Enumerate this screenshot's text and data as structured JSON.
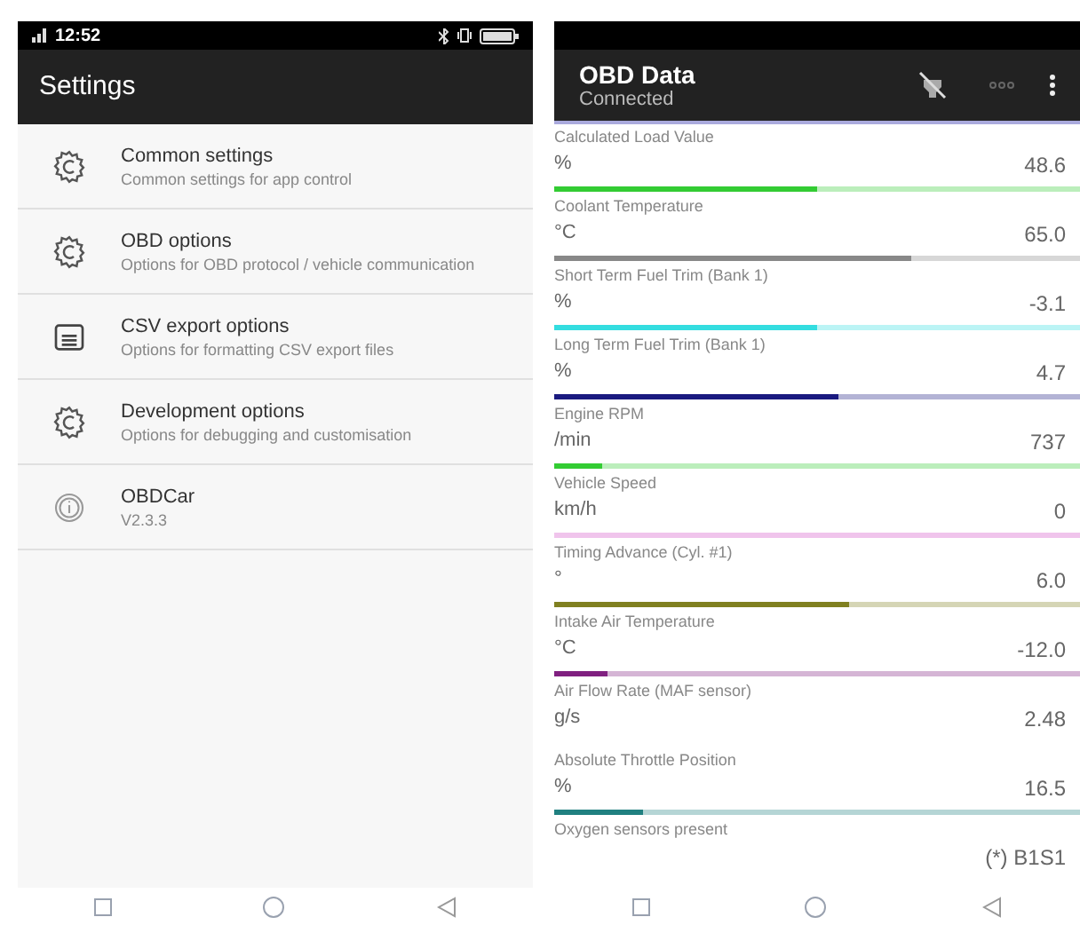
{
  "left_screen": {
    "status_bar": {
      "time": "12:52"
    },
    "title": "Settings",
    "items": [
      {
        "kind": "gear",
        "title": "Common settings",
        "subtitle": "Common settings for app control"
      },
      {
        "kind": "gear",
        "title": "OBD options",
        "subtitle": "Options for OBD protocol / vehicle communication"
      },
      {
        "kind": "document",
        "title": "CSV export options",
        "subtitle": "Options for formatting CSV export files"
      },
      {
        "kind": "gear",
        "title": "Development options",
        "subtitle": "Options for debugging and customisation"
      },
      {
        "kind": "info",
        "title": "OBDCar",
        "subtitle": "V2.3.3"
      }
    ]
  },
  "right_screen": {
    "title": "OBD Data",
    "subtitle": "Connected",
    "rows": [
      {
        "name": "Calculated Load Value",
        "unit": "%",
        "value": "48.6",
        "level": 0.5,
        "color": "#33cc33"
      },
      {
        "name": "Coolant Temperature",
        "unit": "°C",
        "value": "65.0",
        "level": 0.68,
        "color": "#888888"
      },
      {
        "name": "Short Term Fuel Trim (Bank 1)",
        "unit": "%",
        "value": "-3.1",
        "level": 0.5,
        "color": "#33dde0"
      },
      {
        "name": "Long Term Fuel Trim (Bank 1)",
        "unit": "%",
        "value": "4.7",
        "level": 0.54,
        "color": "#1a1a80"
      },
      {
        "name": "Engine RPM",
        "unit": "/min",
        "value": "737",
        "level": 0.09,
        "color": "#33cc33"
      },
      {
        "name": "Vehicle Speed",
        "unit": "km/h",
        "value": "0",
        "level": 0,
        "color": "#f0c4ec"
      },
      {
        "name": "Timing Advance (Cyl. #1)",
        "unit": "°",
        "value": "6.0",
        "level": 0.56,
        "color": "#808020"
      },
      {
        "name": "Intake Air Temperature",
        "unit": "°C",
        "value": "-12.0",
        "level": 0.1,
        "color": "#802080"
      },
      {
        "name": "Air Flow Rate (MAF sensor)",
        "unit": "g/s",
        "value": "2.48"
      },
      {
        "name": "Absolute Throttle Position",
        "unit": "%",
        "value": "16.5",
        "level": 0.17,
        "color": "#208080"
      },
      {
        "name": "Oxygen sensors present",
        "value": "(*) B1S1"
      }
    ]
  }
}
